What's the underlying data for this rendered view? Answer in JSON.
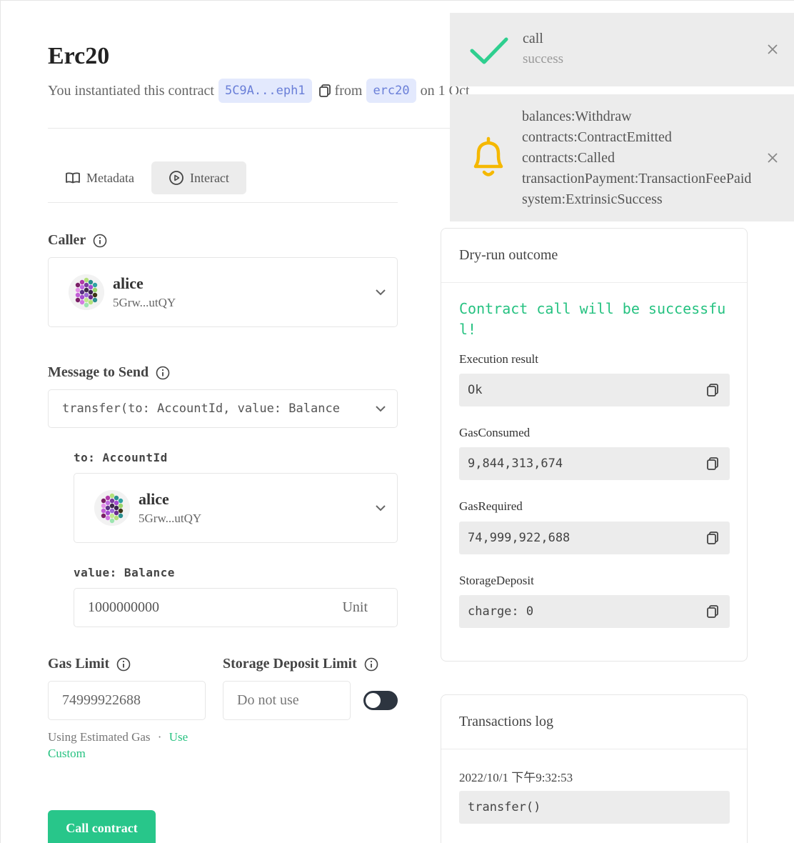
{
  "contract": {
    "name": "Erc20",
    "intro_text": "You instantiated this contract",
    "address_short": "5C9A...eph1",
    "from_text": "from",
    "code_name": "erc20",
    "date_text": "on 1 Oct"
  },
  "tabs": [
    {
      "label": "Metadata",
      "icon": "book-icon",
      "active": false
    },
    {
      "label": "Interact",
      "icon": "play-circle-icon",
      "active": true
    }
  ],
  "caller": {
    "label": "Caller",
    "account_name": "alice",
    "account_address": "5Grw...utQY"
  },
  "message": {
    "label": "Message to Send",
    "selected": "transfer(to: AccountId, value: Balance",
    "params": {
      "to_label": "to: AccountId",
      "to_account_name": "alice",
      "to_account_address": "5Grw...utQY",
      "value_label": "value: Balance",
      "value_amount": "1000000000",
      "value_unit": "Unit"
    }
  },
  "gas": {
    "label": "Gas Limit",
    "value": "74999922688",
    "hint_text": "Using Estimated Gas",
    "separator": "·",
    "link_text": "Use Custom"
  },
  "storage": {
    "label": "Storage Deposit Limit",
    "placeholder": "Do not use",
    "toggle_on": false
  },
  "call_button": "Call contract",
  "dry_run": {
    "title": "Dry-run outcome",
    "success_message": "Contract call will be successful!",
    "fields": [
      {
        "label": "Execution result",
        "value": "Ok"
      },
      {
        "label": "GasConsumed",
        "value": "9,844,313,674"
      },
      {
        "label": "GasRequired",
        "value": "74,999,922,688"
      },
      {
        "label": "StorageDeposit",
        "value": "charge: 0"
      }
    ]
  },
  "tx_log": {
    "title": "Transactions log",
    "timestamp": "2022/10/1 下午9:32:53",
    "call": "transfer()"
  },
  "toasts": {
    "success": {
      "title": "call",
      "subtitle": "success",
      "icon": "checkmark-icon"
    },
    "events": {
      "icon": "bell-icon",
      "lines": [
        "balances:Withdraw",
        "contracts:ContractEmitted",
        "contracts:Called",
        "transactionPayment:TransactionFeePaid",
        "system:ExtrinsicSuccess"
      ]
    }
  },
  "colors": {
    "accent_green": "#28c68a",
    "pill_bg": "#e3e9fd",
    "pill_text": "#6a7fd8",
    "bell_yellow": "#f5b800",
    "toggle_dark": "#2d3540"
  }
}
